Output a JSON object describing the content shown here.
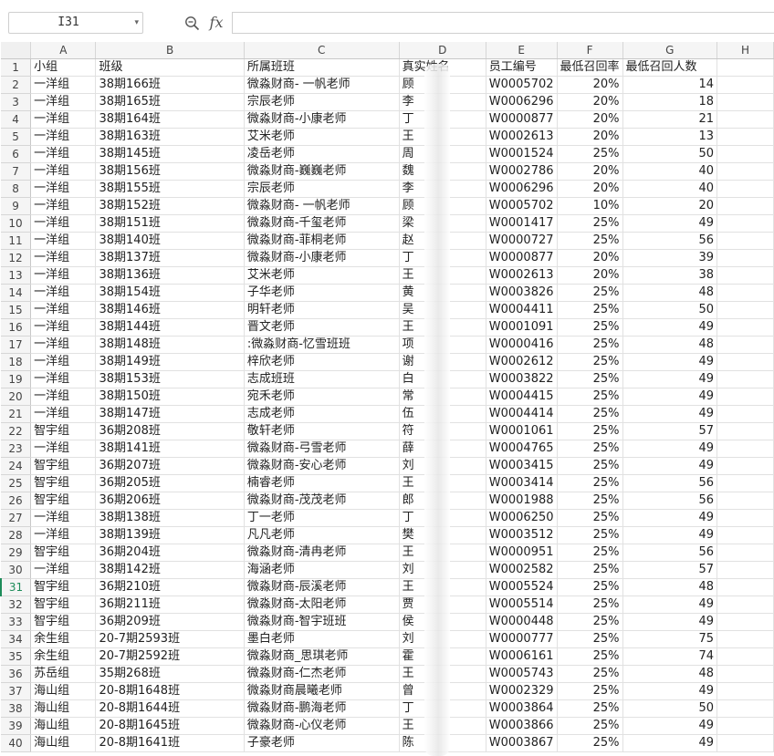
{
  "formula_bar": {
    "cell_ref": "I31",
    "fx_label": "fx",
    "formula_value": ""
  },
  "columns": [
    "A",
    "B",
    "C",
    "D",
    "E",
    "F",
    "G",
    "H"
  ],
  "header_row": {
    "row": "1",
    "cells": [
      "小组",
      "班级",
      "所属班班",
      "真实姓名",
      "员工编号",
      "最低召回率",
      "最低召回人数",
      ""
    ]
  },
  "selected_row": "31",
  "rows": [
    {
      "r": "2",
      "a": "一洋组",
      "b": "38期166班",
      "c": "微淼财商- 一帆老师",
      "d": "顾",
      "e": "W0005702",
      "f": "20%",
      "g": "14"
    },
    {
      "r": "3",
      "a": "一洋组",
      "b": "38期165班",
      "c": "宗辰老师",
      "d": "李",
      "e": "W0006296",
      "f": "20%",
      "g": "18"
    },
    {
      "r": "4",
      "a": "一洋组",
      "b": "38期164班",
      "c": "微淼财商-小康老师",
      "d": "丁",
      "e": "W0000877",
      "f": "20%",
      "g": "21"
    },
    {
      "r": "5",
      "a": "一洋组",
      "b": "38期163班",
      "c": "艾米老师",
      "d": "王",
      "e": "W0002613",
      "f": "20%",
      "g": "13"
    },
    {
      "r": "6",
      "a": "一洋组",
      "b": "38期145班",
      "c": "凌岳老师",
      "d": "周",
      "e": "W0001524",
      "f": "25%",
      "g": "50"
    },
    {
      "r": "7",
      "a": "一洋组",
      "b": "38期156班",
      "c": "微淼财商-巍巍老师",
      "d": "魏",
      "e": "W0002786",
      "f": "20%",
      "g": "40"
    },
    {
      "r": "8",
      "a": "一洋组",
      "b": "38期155班",
      "c": "宗辰老师",
      "d": "李",
      "e": "W0006296",
      "f": "20%",
      "g": "40"
    },
    {
      "r": "9",
      "a": "一洋组",
      "b": "38期152班",
      "c": "微淼财商- 一帆老师",
      "d": "顾",
      "e": "W0005702",
      "f": "10%",
      "g": "20"
    },
    {
      "r": "10",
      "a": "一洋组",
      "b": "38期151班",
      "c": "微淼财商-千玺老师",
      "d": "梁",
      "e": "W0001417",
      "f": "25%",
      "g": "49"
    },
    {
      "r": "11",
      "a": "一洋组",
      "b": "38期140班",
      "c": "微淼财商-菲桐老师",
      "d": "赵",
      "e": "W0000727",
      "f": "25%",
      "g": "56"
    },
    {
      "r": "12",
      "a": "一洋组",
      "b": "38期137班",
      "c": "微淼财商-小康老师",
      "d": "丁",
      "e": "W0000877",
      "f": "20%",
      "g": "39"
    },
    {
      "r": "13",
      "a": "一洋组",
      "b": "38期136班",
      "c": "艾米老师",
      "d": "王",
      "e": "W0002613",
      "f": "20%",
      "g": "38"
    },
    {
      "r": "14",
      "a": "一洋组",
      "b": "38期154班",
      "c": "子华老师",
      "d": "黄",
      "e": "W0003826",
      "f": "25%",
      "g": "48"
    },
    {
      "r": "15",
      "a": "一洋组",
      "b": "38期146班",
      "c": "明轩老师",
      "d": "吴",
      "e": "W0004411",
      "f": "25%",
      "g": "50"
    },
    {
      "r": "16",
      "a": "一洋组",
      "b": "38期144班",
      "c": "晋文老师",
      "d": "王",
      "e": "W0001091",
      "f": "25%",
      "g": "49"
    },
    {
      "r": "17",
      "a": "一洋组",
      "b": "38期148班",
      "c": ":微淼财商-忆雪班班",
      "d": "项",
      "e": "W0000416",
      "f": "25%",
      "g": "48"
    },
    {
      "r": "18",
      "a": "一洋组",
      "b": "38期149班",
      "c": "梓欣老师",
      "d": "谢",
      "e": "W0002612",
      "f": "25%",
      "g": "49"
    },
    {
      "r": "19",
      "a": "一洋组",
      "b": "38期153班",
      "c": "志成班班",
      "d": "白",
      "e": "W0003822",
      "f": "25%",
      "g": "49"
    },
    {
      "r": "20",
      "a": "一洋组",
      "b": "38期150班",
      "c": "宛禾老师",
      "d": "常",
      "e": "W0004415",
      "f": "25%",
      "g": "49"
    },
    {
      "r": "21",
      "a": "一洋组",
      "b": "38期147班",
      "c": "志成老师",
      "d": "伍",
      "e": "W0004414",
      "f": "25%",
      "g": "49"
    },
    {
      "r": "22",
      "a": "智宇组",
      "b": "36期208班",
      "c": "敬轩老师",
      "d": "符",
      "e": "W0001061",
      "f": "25%",
      "g": "57"
    },
    {
      "r": "23",
      "a": "一洋组",
      "b": "38期141班",
      "c": "微淼财商-弓雪老师",
      "d": "薛",
      "e": "W0004765",
      "f": "25%",
      "g": "49"
    },
    {
      "r": "24",
      "a": "智宇组",
      "b": "36期207班",
      "c": "微淼财商-安心老师",
      "d": "刘",
      "e": "W0003415",
      "f": "25%",
      "g": "49"
    },
    {
      "r": "25",
      "a": "智宇组",
      "b": "36期205班",
      "c": "楠睿老师",
      "d": "王",
      "e": "W0003414",
      "f": "25%",
      "g": "56"
    },
    {
      "r": "26",
      "a": "智宇组",
      "b": "36期206班",
      "c": "微淼财商-茂茂老师",
      "d": "郎",
      "e": "W0001988",
      "f": "25%",
      "g": "56"
    },
    {
      "r": "27",
      "a": "一洋组",
      "b": "38期138班",
      "c": "丁一老师",
      "d": "丁",
      "e": "W0006250",
      "f": "25%",
      "g": "49"
    },
    {
      "r": "28",
      "a": "一洋组",
      "b": "38期139班",
      "c": "凡凡老师",
      "d": "樊",
      "e": "W0003512",
      "f": "25%",
      "g": "49"
    },
    {
      "r": "29",
      "a": "智宇组",
      "b": "36期204班",
      "c": "微淼财商-清冉老师",
      "d": "王",
      "e": "W0000951",
      "f": "25%",
      "g": "56"
    },
    {
      "r": "30",
      "a": "一洋组",
      "b": "38期142班",
      "c": "海涵老师",
      "d": "刘",
      "e": "W0002582",
      "f": "25%",
      "g": "57"
    },
    {
      "r": "31",
      "a": "智宇组",
      "b": "36期210班",
      "c": "微淼财商-辰溪老师",
      "d": "王",
      "e": "W0005524",
      "f": "25%",
      "g": "48"
    },
    {
      "r": "32",
      "a": "智宇组",
      "b": "36期211班",
      "c": "微淼财商-太阳老师",
      "d": "贾",
      "e": "W0005514",
      "f": "25%",
      "g": "49"
    },
    {
      "r": "33",
      "a": "智宇组",
      "b": "36期209班",
      "c": "微淼财商-智宇班班",
      "d": "侯",
      "e": "W0000448",
      "f": "25%",
      "g": "49"
    },
    {
      "r": "34",
      "a": "余生组",
      "b": "20-7期2593班",
      "c": "墨白老师",
      "d": "刘",
      "e": "W0000777",
      "f": "25%",
      "g": "75"
    },
    {
      "r": "35",
      "a": "余生组",
      "b": "20-7期2592班",
      "c": "微淼财商_思琪老师",
      "d": "霍",
      "e": "W0006161",
      "f": "25%",
      "g": "74"
    },
    {
      "r": "36",
      "a": "苏岳组",
      "b": "35期268班",
      "c": "微淼财商-仁杰老师",
      "d": "王",
      "e": "W0005743",
      "f": "25%",
      "g": "48"
    },
    {
      "r": "37",
      "a": "海山组",
      "b": "20-8期1648班",
      "c": "微淼财商晨曦老师",
      "d": "曾",
      "e": "W0002329",
      "f": "25%",
      "g": "49"
    },
    {
      "r": "38",
      "a": "海山组",
      "b": "20-8期1644班",
      "c": "微淼财商-鹏海老师",
      "d": "丁",
      "e": "W0003864",
      "f": "25%",
      "g": "50"
    },
    {
      "r": "39",
      "a": "海山组",
      "b": "20-8期1645班",
      "c": "微淼财商-心仪老师",
      "d": "王",
      "e": "W0003866",
      "f": "25%",
      "g": "49"
    },
    {
      "r": "40",
      "a": "海山组",
      "b": "20-8期1641班",
      "c": "子豪老师",
      "d": "陈",
      "e": "W0003867",
      "f": "25%",
      "g": "49"
    }
  ]
}
